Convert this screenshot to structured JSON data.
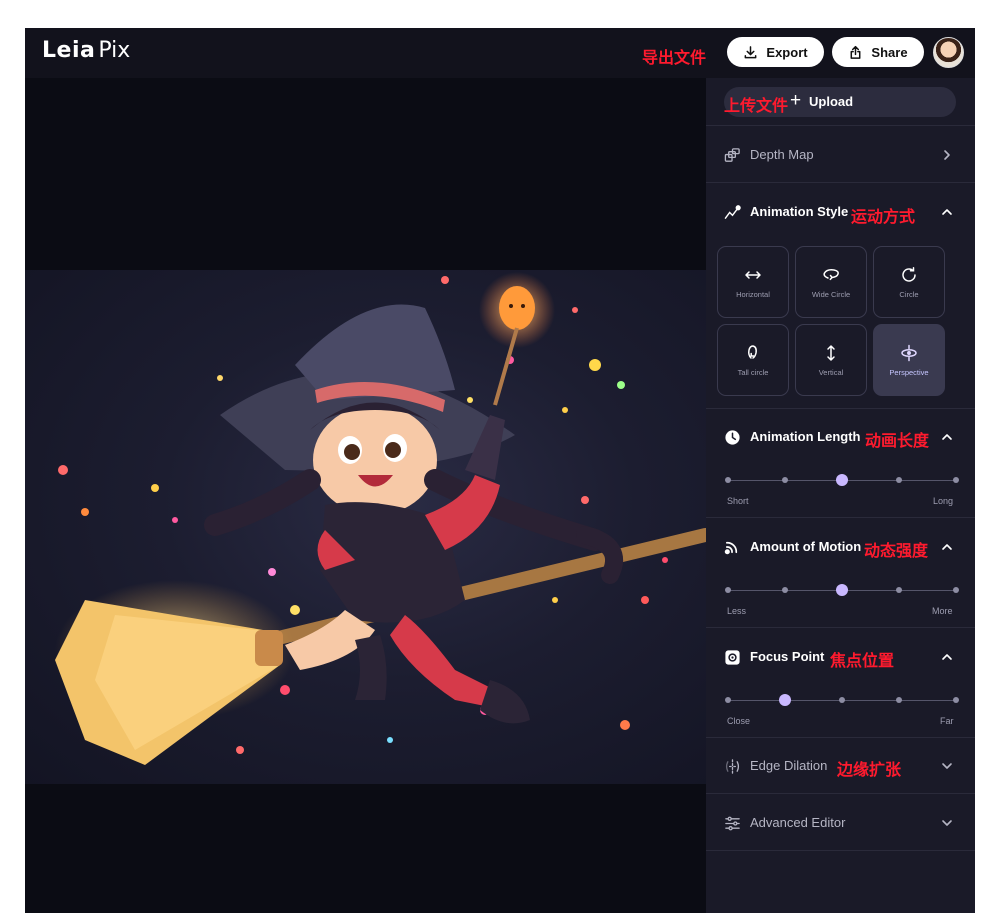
{
  "header": {
    "logo_main": "Leia",
    "logo_sub": "Pix",
    "export_label": "Export",
    "share_label": "Share",
    "export_annotation": "导出文件"
  },
  "sidebar": {
    "upload_label": "Upload",
    "upload_annotation": "上传文件",
    "depth_map_title": "Depth Map",
    "animation_style": {
      "title": "Animation Style",
      "annotation": "运动方式",
      "options": [
        {
          "label": "Horizontal",
          "icon": "horizontal-arrows-icon",
          "active": false
        },
        {
          "label": "Wide Circle",
          "icon": "wide-circle-icon",
          "active": false
        },
        {
          "label": "Circle",
          "icon": "circle-arrow-icon",
          "active": false
        },
        {
          "label": "Tall circle",
          "icon": "tall-circle-icon",
          "active": false
        },
        {
          "label": "Vertical",
          "icon": "vertical-arrows-icon",
          "active": false
        },
        {
          "label": "Perspective",
          "icon": "perspective-icon",
          "active": true
        }
      ]
    },
    "animation_length": {
      "title": "Animation Length",
      "annotation": "动画长度",
      "min_label": "Short",
      "max_label": "Long",
      "steps": 5,
      "value_index": 2
    },
    "amount_of_motion": {
      "title": "Amount of Motion",
      "annotation": "动态强度",
      "min_label": "Less",
      "max_label": "More",
      "steps": 5,
      "value_index": 2
    },
    "focus_point": {
      "title": "Focus Point",
      "annotation": "焦点位置",
      "min_label": "Close",
      "max_label": "Far",
      "steps": 5,
      "value_index": 1
    },
    "edge_dilation": {
      "title": "Edge Dilation",
      "annotation": "边缘扩张"
    },
    "advanced_editor_title": "Advanced Editor"
  },
  "colors": {
    "annotation": "#ff1a2e",
    "accent": "#c9b8ff",
    "panel": "#1a1a28"
  }
}
